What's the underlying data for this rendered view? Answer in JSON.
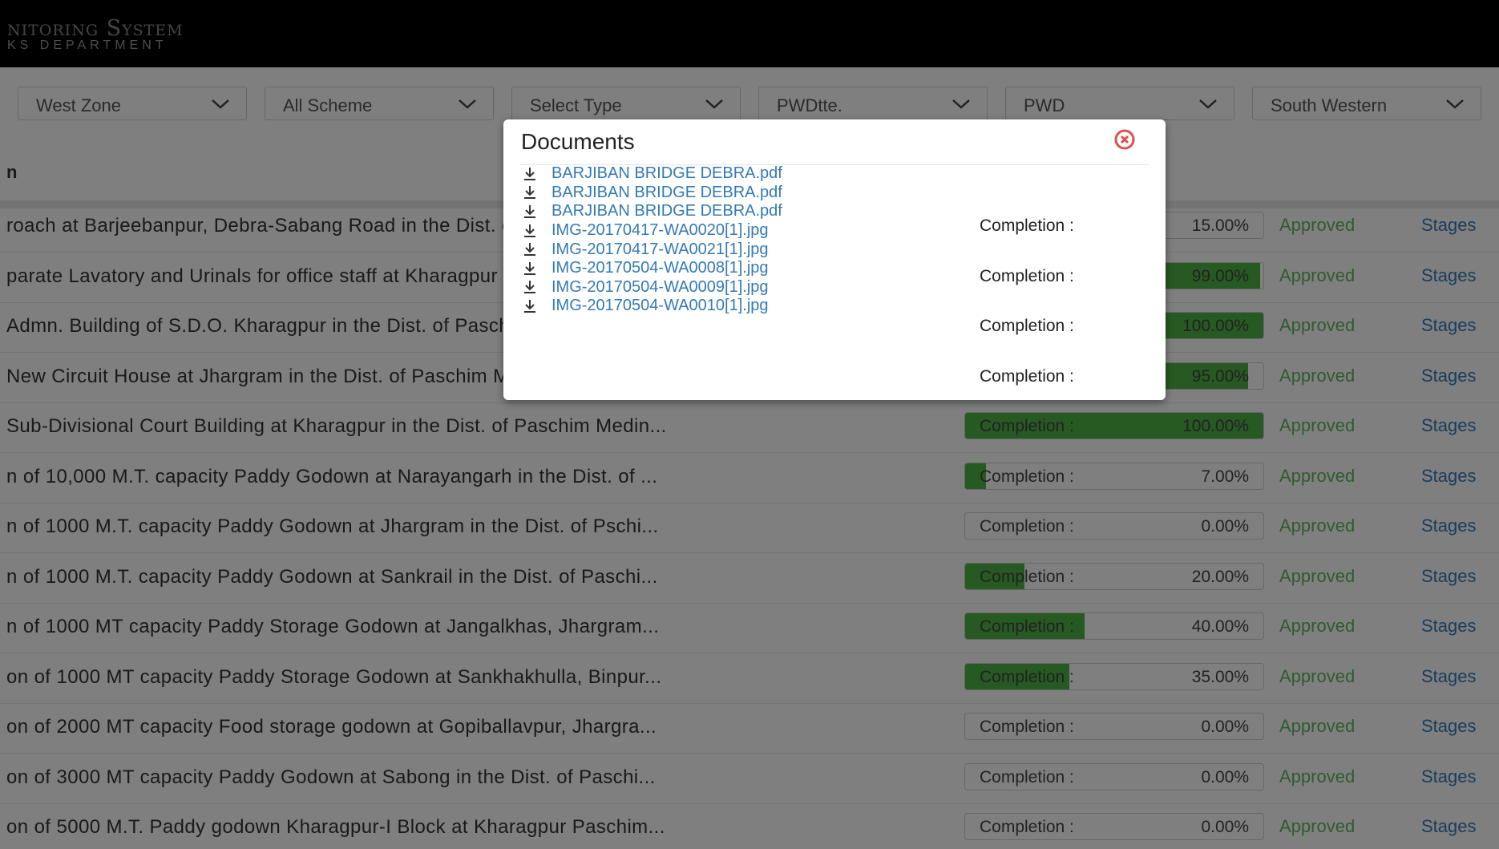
{
  "header": {
    "title": "nitoring System",
    "subtitle": "KS DEPARTMENT"
  },
  "filters": [
    {
      "label": "West Zone"
    },
    {
      "label": "All Scheme"
    },
    {
      "label": "Select Type"
    },
    {
      "label": "PWDtte."
    },
    {
      "label": "PWD"
    },
    {
      "label": "South Western"
    }
  ],
  "table": {
    "header_label": "n",
    "completion_label": "Completion :",
    "rows": [
      {
        "name": "roach at Barjeebanpur, Debra-Sabang Road in the Dist. of Paschim Medinipur",
        "completion": 15.0,
        "completion_text": "15.00%",
        "status": "Approved",
        "stage": "Stages"
      },
      {
        "name": "parate Lavatory and Urinals for office staff at Kharagpur",
        "completion": 99.0,
        "completion_text": "99.00%",
        "status": "Approved",
        "stage": "Stages"
      },
      {
        "name": "Admn. Building of S.D.O. Kharagpur in the Dist. of Paschim Medinipur",
        "completion": 100.0,
        "completion_text": "100.00%",
        "status": "Approved",
        "stage": "Stages"
      },
      {
        "name": "New Circuit House at Jhargram in the Dist. of Paschim Medinipur",
        "completion": 95.0,
        "completion_text": "95.00%",
        "status": "Approved",
        "stage": "Stages"
      },
      {
        "name": "Sub-Divisional Court Building at Kharagpur in the Dist. of Paschim Medin...",
        "completion": 100.0,
        "completion_text": "100.00%",
        "status": "Approved",
        "stage": "Stages"
      },
      {
        "name": "n of 10,000 M.T. capacity Paddy Godown at Narayangarh in the Dist. of ...",
        "completion": 7.0,
        "completion_text": "7.00%",
        "status": "Approved",
        "stage": "Stages"
      },
      {
        "name": "n of 1000 M.T. capacity Paddy Godown at Jhargram in the Dist. of Pschi...",
        "completion": 0.0,
        "completion_text": "0.00%",
        "status": "Approved",
        "stage": "Stages"
      },
      {
        "name": "n of 1000 M.T. capacity Paddy Godown at Sankrail in the Dist. of Paschi...",
        "completion": 20.0,
        "completion_text": "20.00%",
        "status": "Approved",
        "stage": "Stages"
      },
      {
        "name": "n of 1000 MT capacity Paddy Storage Godown at Jangalkhas, Jhargram...",
        "completion": 40.0,
        "completion_text": "40.00%",
        "status": "Approved",
        "stage": "Stages"
      },
      {
        "name": "on of 1000 MT capacity Paddy Storage Godown at Sankhakhulla, Binpur...",
        "completion": 35.0,
        "completion_text": "35.00%",
        "status": "Approved",
        "stage": "Stages"
      },
      {
        "name": "on of 2000 MT capacity Food storage godown at Gopiballavpur, Jhargra...",
        "completion": 0.0,
        "completion_text": "0.00%",
        "status": "Approved",
        "stage": "Stages"
      },
      {
        "name": "on of 3000 MT capacity Paddy Godown at Sabong in the Dist. of Paschi...",
        "completion": 0.0,
        "completion_text": "0.00%",
        "status": "Approved",
        "stage": "Stages"
      },
      {
        "name": "on of 5000 M.T. Paddy godown Kharagpur-I Block at Kharagpur Paschim...",
        "completion": 0.0,
        "completion_text": "0.00%",
        "status": "Approved",
        "stage": "Stages"
      }
    ]
  },
  "modal": {
    "title": "Documents",
    "documents": [
      "BARJIBAN BRIDGE DEBRA.pdf",
      "BARJIBAN BRIDGE DEBRA.pdf",
      "BARJIBAN BRIDGE DEBRA.pdf",
      "IMG-20170417-WA0020[1].jpg",
      "IMG-20170417-WA0021[1].jpg",
      "IMG-20170504-WA0008[1].jpg",
      "IMG-20170504-WA0009[1].jpg",
      "IMG-20170504-WA0010[1].jpg"
    ]
  },
  "colors": {
    "header_bg": "#000000",
    "progress_fill": "#4fb345",
    "approved": "#5cb85c",
    "link": "#337ab7",
    "close": "#d9534f"
  },
  "icons": {
    "filter_toggle": "chevron-down-icon",
    "modal_close": "close-circle-icon",
    "document": "download-icon"
  }
}
